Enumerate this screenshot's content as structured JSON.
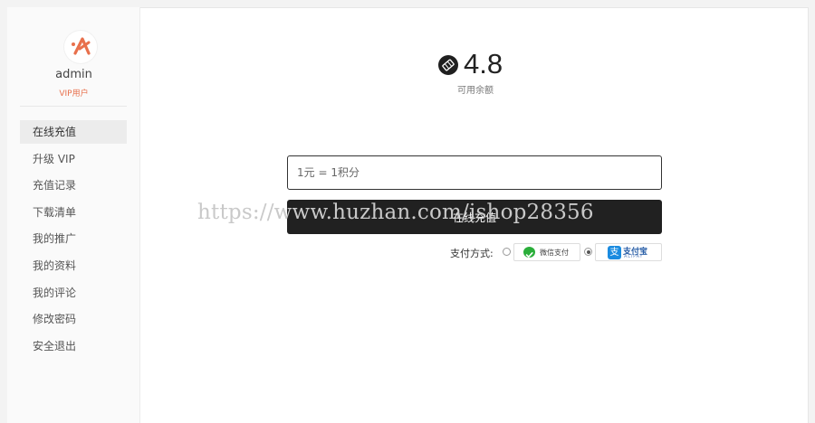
{
  "user": {
    "name": "admin",
    "level": "VIP用户",
    "logo_icon": "brand-logo-icon"
  },
  "sidebar": {
    "items": [
      {
        "label": "在线充值",
        "active": true
      },
      {
        "label": "升级 VIP",
        "active": false
      },
      {
        "label": "充值记录",
        "active": false
      },
      {
        "label": "下载清单",
        "active": false
      },
      {
        "label": "我的推广",
        "active": false
      },
      {
        "label": "我的资料",
        "active": false
      },
      {
        "label": "我的评论",
        "active": false
      },
      {
        "label": "修改密码",
        "active": false
      },
      {
        "label": "安全退出",
        "active": false
      }
    ]
  },
  "balance": {
    "value": "4.8",
    "label": "可用余额",
    "icon": "coin-icon"
  },
  "recharge": {
    "placeholder": "1元 = 1积分",
    "submit_label": "在线充值"
  },
  "payment": {
    "label": "支付方式:",
    "methods": [
      {
        "name": "微信支付",
        "icon": "wechat-icon",
        "selected": false
      },
      {
        "name": "支付宝",
        "sub": "ALIPAY",
        "icon": "alipay-icon",
        "selected": true
      }
    ]
  },
  "watermark": "https://www.huzhan.com/ishop28356",
  "colors": {
    "accent": "#e8704c",
    "button": "#212121",
    "wechat": "#2aae3a",
    "alipay": "#1a8be0"
  }
}
